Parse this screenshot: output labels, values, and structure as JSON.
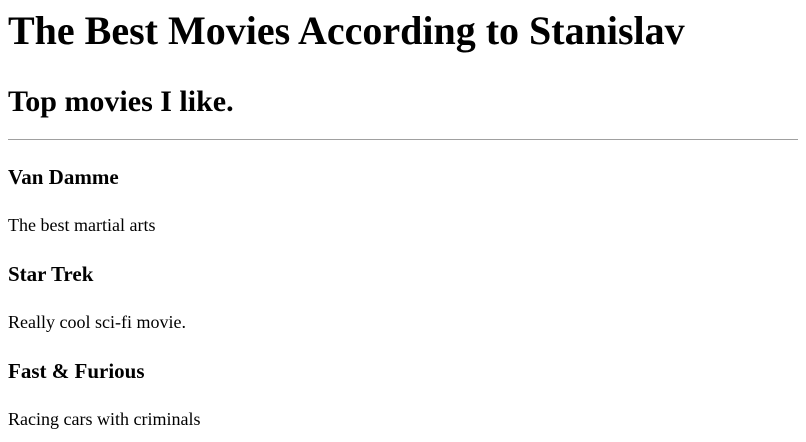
{
  "page": {
    "title": "The Best Movies According to Stanislav",
    "subtitle": "Top movies I like."
  },
  "movies": [
    {
      "name": "Van Damme",
      "description": "The best martial arts"
    },
    {
      "name": "Star Trek",
      "description": "Really cool sci-fi movie."
    },
    {
      "name": "Fast & Furious",
      "description": "Racing cars with criminals"
    }
  ]
}
